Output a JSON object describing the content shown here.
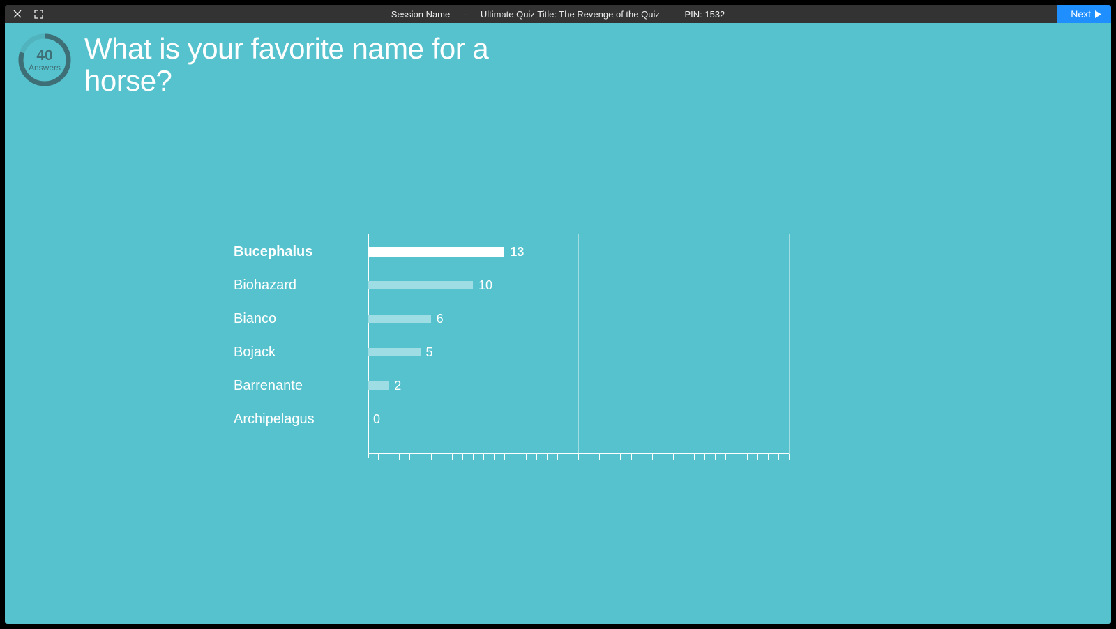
{
  "titlebar": {
    "session_label": "Session Name",
    "separator": "-",
    "quiz_title": "Ultimate Quiz Title: The Revenge of the Quiz",
    "pin_label": "PIN: 1532",
    "next_label": "Next"
  },
  "answers_ring": {
    "count": "40",
    "label": "Answers",
    "fraction": 0.8
  },
  "question": "What is your favorite name for a horse?",
  "chart_data": {
    "type": "bar",
    "orientation": "horizontal",
    "title": "",
    "xlabel": "",
    "ylabel": "",
    "xlim": [
      0,
      40
    ],
    "major_gridlines": [
      20,
      40
    ],
    "minor_tick_step": 1,
    "categories": [
      "Bucephalus",
      "Biohazard",
      "Bianco",
      "Bojack",
      "Barrenante",
      "Archipelagus"
    ],
    "values": [
      13,
      10,
      6,
      5,
      2,
      0
    ],
    "highlight_index": 0
  },
  "colors": {
    "background": "#56c2cd",
    "bar_default": "#9edde4",
    "bar_highlight": "#ffffff",
    "accent_blue": "#1f8eff",
    "ring": "#3f6f76"
  }
}
